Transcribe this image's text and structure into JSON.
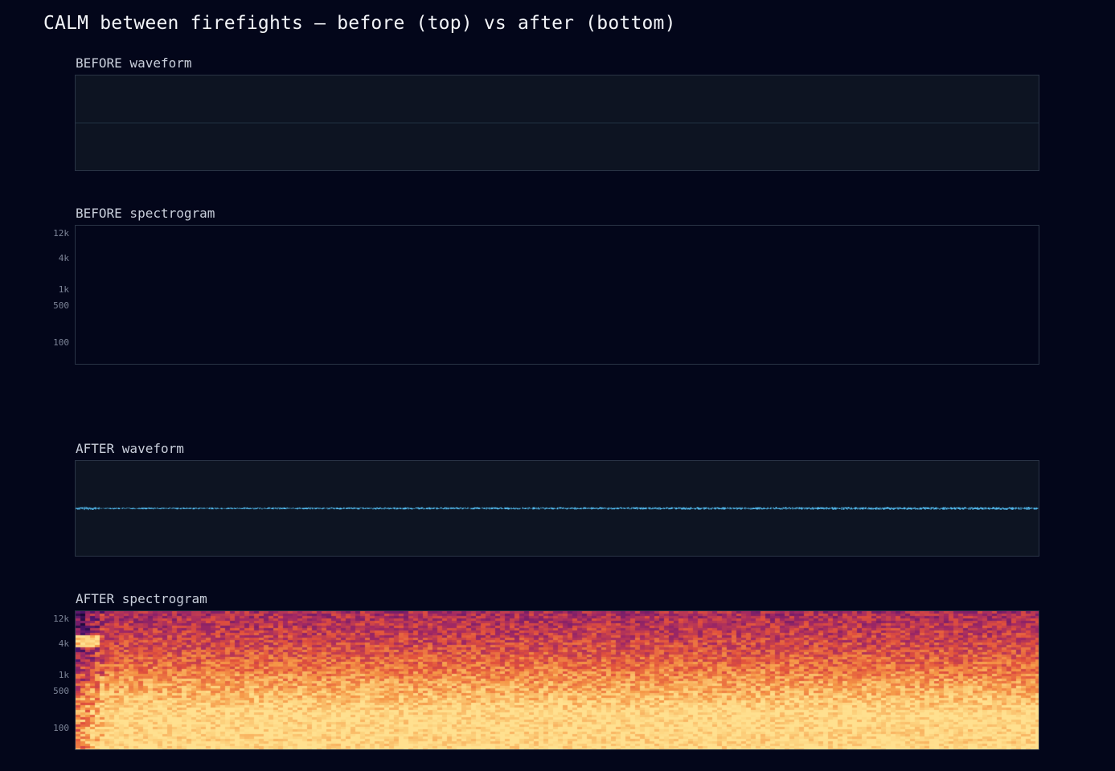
{
  "title": "CALM between firefights — before (top) vs after (bottom)",
  "panels": {
    "before_waveform": {
      "label": "BEFORE waveform"
    },
    "before_spectrogram": {
      "label": "BEFORE spectrogram"
    },
    "after_waveform": {
      "label": "AFTER waveform"
    },
    "after_spectrogram": {
      "label": "AFTER spectrogram"
    }
  },
  "colors": {
    "background": "#03061a",
    "waveform_bg": "#0d1422",
    "waveform_line": "#4fb3e6",
    "spec_low": "#2a0a4a",
    "spec_mid": "#e8533a",
    "spec_high": "#ffe08f"
  },
  "chart_data": [
    {
      "type": "line",
      "name": "BEFORE waveform",
      "x": [
        0,
        1
      ],
      "y": [
        0,
        0
      ],
      "ylim": [
        -1,
        1
      ]
    },
    {
      "type": "heatmap",
      "name": "BEFORE spectrogram",
      "yscale": "log",
      "yticks": [
        "12k",
        "4k",
        "1k",
        "500",
        "100"
      ],
      "values": "empty"
    },
    {
      "type": "line",
      "name": "AFTER waveform",
      "x": [
        0,
        0.02,
        1
      ],
      "y": [
        0.03,
        0.01,
        0.02
      ],
      "ylim": [
        -1,
        1
      ]
    },
    {
      "type": "heatmap",
      "name": "AFTER spectrogram",
      "yscale": "log",
      "yticks": [
        "12k",
        "4k",
        "1k",
        "500",
        "100"
      ],
      "values": "high energy below ~200 Hz (yellow), mid orange 500–1k, darker purple/red above 4k; burst at start"
    }
  ]
}
